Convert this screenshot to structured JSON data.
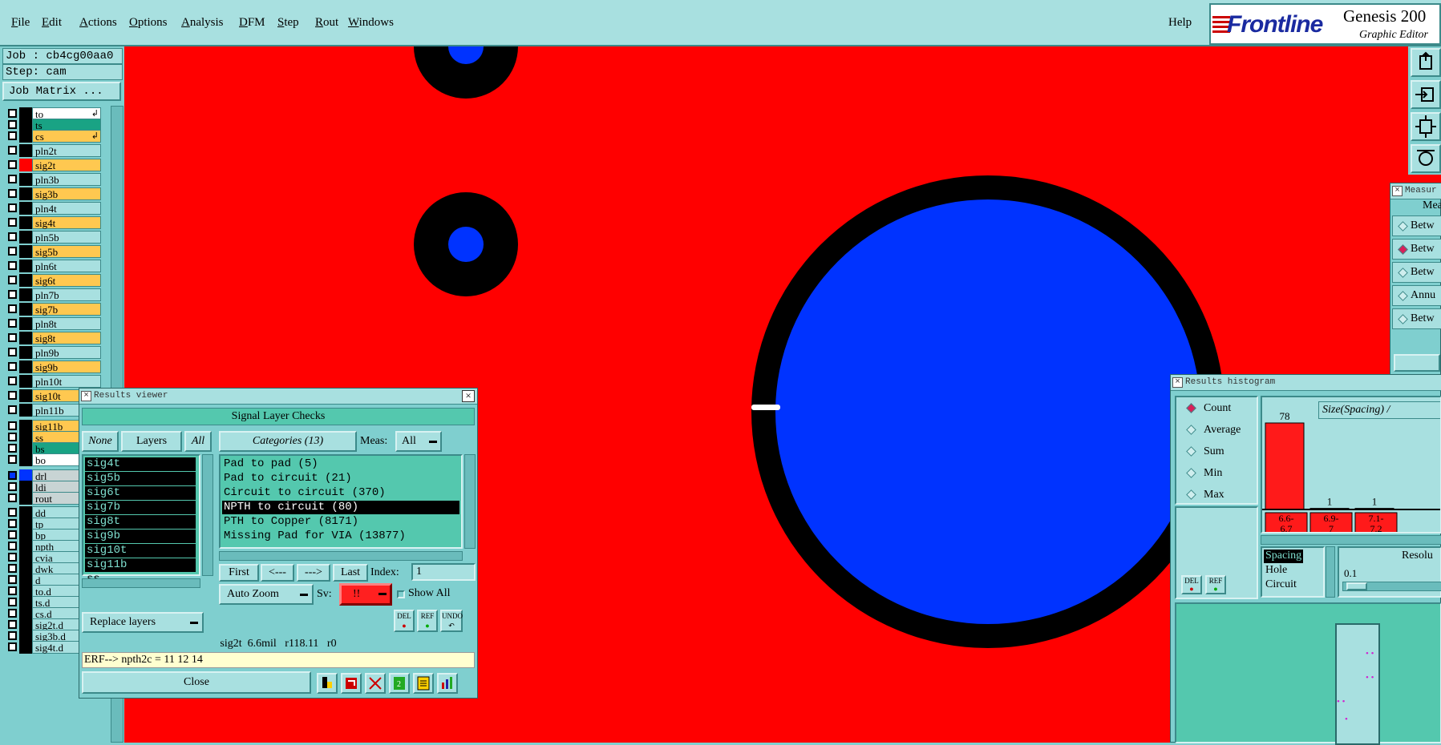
{
  "menubar": {
    "items": [
      {
        "label": "File",
        "ul": "F",
        "rest": "ile"
      },
      {
        "label": "Edit",
        "ul": "E",
        "rest": "dit"
      },
      {
        "label": "Actions",
        "ul": "A",
        "rest": "ctions"
      },
      {
        "label": "Options",
        "ul": "O",
        "rest": "ptions"
      },
      {
        "label": "Analysis",
        "ul": "A",
        "rest": "nalysis"
      },
      {
        "label": "DFM",
        "ul": "D",
        "rest": "FM"
      },
      {
        "label": "Step",
        "ul": "S",
        "rest": "tep"
      },
      {
        "label": "Rout",
        "ul": "R",
        "rest": "out"
      },
      {
        "label": "Windows",
        "ul": "W",
        "rest": "indows"
      }
    ],
    "help": "Help"
  },
  "brand": {
    "logo": "Frontline",
    "title": "Genesis 200",
    "subtitle": "Graphic Editor"
  },
  "job": {
    "job_label": "Job : cb4cg00aa0",
    "step_label": "Step: cam",
    "matrix_button": "Job Matrix ..."
  },
  "layers": [
    {
      "name": "to",
      "type": "wh",
      "arrow": true
    },
    {
      "name": "ts",
      "type": "sm"
    },
    {
      "name": "cs",
      "type": "sig",
      "arrow": true
    },
    {
      "name": "pln2t",
      "type": "pln"
    },
    {
      "name": "sig2t",
      "type": "sig",
      "swatch": "#ff0000"
    },
    {
      "name": "pln3b",
      "type": "pln"
    },
    {
      "name": "sig3b",
      "type": "sig"
    },
    {
      "name": "pln4t",
      "type": "pln"
    },
    {
      "name": "sig4t",
      "type": "sig"
    },
    {
      "name": "pln5b",
      "type": "pln"
    },
    {
      "name": "sig5b",
      "type": "sig"
    },
    {
      "name": "pln6t",
      "type": "pln"
    },
    {
      "name": "sig6t",
      "type": "sig"
    },
    {
      "name": "pln7b",
      "type": "pln"
    },
    {
      "name": "sig7b",
      "type": "sig"
    },
    {
      "name": "pln8t",
      "type": "pln"
    },
    {
      "name": "sig8t",
      "type": "sig"
    },
    {
      "name": "pln9b",
      "type": "pln"
    },
    {
      "name": "sig9b",
      "type": "sig"
    },
    {
      "name": "pln10t",
      "type": "pln"
    },
    {
      "name": "sig10t",
      "type": "sig"
    },
    {
      "name": "pln11b",
      "type": "pln"
    },
    {
      "name": "sig11b",
      "type": "sig"
    },
    {
      "name": "ss",
      "type": "sig"
    },
    {
      "name": "bs",
      "type": "sm"
    },
    {
      "name": "bo",
      "type": "wh"
    },
    {
      "name": "drl",
      "type": "gr",
      "swatch": "#0033ff",
      "checked": true
    },
    {
      "name": "ldi",
      "type": "gr"
    },
    {
      "name": "rout",
      "type": "gr"
    },
    {
      "name": "dd",
      "type": "pln"
    },
    {
      "name": "tp",
      "type": "pln"
    },
    {
      "name": "bp",
      "type": "pln"
    },
    {
      "name": "npth",
      "type": "pln"
    },
    {
      "name": "cvia",
      "type": "pln"
    },
    {
      "name": "dwk",
      "type": "pln"
    },
    {
      "name": "d",
      "type": "pln"
    },
    {
      "name": "to.d",
      "type": "pln"
    },
    {
      "name": "ts.d",
      "type": "pln"
    },
    {
      "name": "cs.d",
      "type": "pln"
    },
    {
      "name": "sig2t.d",
      "type": "pln"
    },
    {
      "name": "sig3b.d",
      "type": "pln"
    },
    {
      "name": "sig4t.d",
      "type": "pln"
    }
  ],
  "results_viewer": {
    "title": "Results viewer",
    "header": "Signal Layer Checks",
    "none_btn": "None",
    "layers_btn": "Layers",
    "all_btn": "All",
    "categories_btn": "Categories (13)",
    "meas_label": "Meas:",
    "meas_value": "All",
    "layer_items": [
      "sig4t",
      "sig5b",
      "sig6t",
      "sig7b",
      "sig8t",
      "sig9b",
      "sig10t",
      "sig11b",
      "ss"
    ],
    "category_items": [
      "Pad to pad (5)",
      "Pad to circuit (21)",
      "Circuit to circuit (370)",
      "NPTH to circuit (80)",
      "PTH to Copper (8171)",
      "Missing Pad for VIA (13877)"
    ],
    "selected_category": 3,
    "first_btn": "First",
    "prev_btn": "<---",
    "next_btn": "--->",
    "last_btn": "Last",
    "index_label": "Index:",
    "index_value": "1",
    "autozoom_btn": "Auto Zoom",
    "sv_label": "Sv:",
    "sv_value": "!!",
    "showall_label": "Show All",
    "replace_btn": "Replace layers",
    "del_btn": "DEL",
    "ref_btn": "REF",
    "undo_btn": "UNDO",
    "status": "sig2t  6.6mil   r118.11   r0",
    "erf": "ERF--> npth2c = 11 12 14",
    "close_btn": "Close"
  },
  "measurement": {
    "title": "Measur",
    "header": "Mea",
    "items": [
      "Betw",
      "Betw",
      "Betw",
      "Annu",
      "Betw"
    ],
    "selected": 1
  },
  "histogram": {
    "title": "Results histogram",
    "modes": [
      "Count",
      "Average",
      "Sum",
      "Min",
      "Max"
    ],
    "selected_mode": 0,
    "chart_title": "Size(Spacing) /",
    "del_btn": "DEL",
    "ref_btn": "REF",
    "bins": [
      {
        "label_top": "6.6-",
        "label_bottom": "6.7",
        "count": 78
      },
      {
        "label_top": "6.9-",
        "label_bottom": "7",
        "count": 1
      },
      {
        "label_top": "7.1-",
        "label_bottom": "7.2",
        "count": 1
      }
    ],
    "types": [
      "Spacing",
      "Hole",
      "Circuit"
    ],
    "selected_type": 0,
    "resolution_label": "Resolu",
    "resolution_value": "0.1"
  },
  "colors": {
    "canvas": "#ff0000",
    "pad": "#0033ff",
    "ring": "#000000",
    "bar": "#ff1a1a",
    "ui": "#7fcfcf"
  }
}
